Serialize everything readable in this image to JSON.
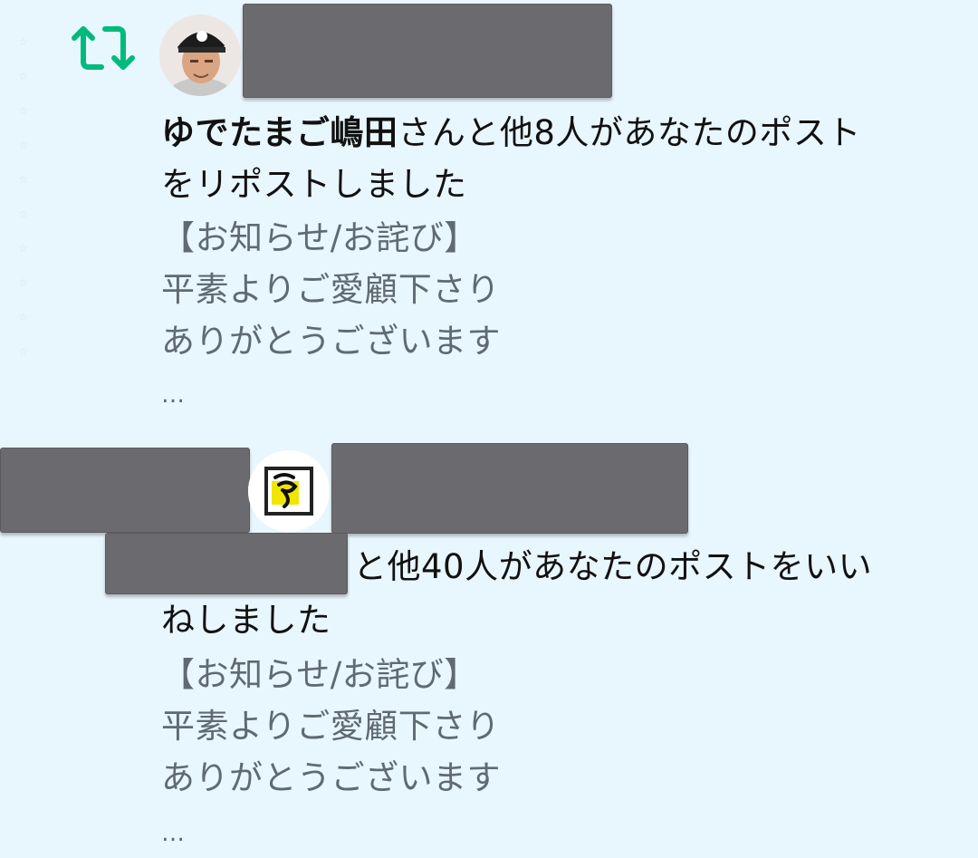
{
  "notifications": [
    {
      "type": "repost",
      "icon": "repost-icon",
      "actor_name": "ゆでたまご嶋田",
      "summary_rest": "さんと他8人があなたのポスト",
      "summary_line2": "をリポストしました",
      "preview_lines": [
        "【お知らせ/お詫び】",
        "平素よりご愛顧下さり",
        "ありがとうございます"
      ],
      "ellipsis": "…"
    },
    {
      "type": "like",
      "summary_rest": "と他40人があなたのポストをいい",
      "summary_line2": "ねしました",
      "preview_lines": [
        "【お知らせ/お詫び】",
        "平素よりご愛顧下さり",
        "ありがとうございます"
      ],
      "ellipsis": "…"
    }
  ],
  "colors": {
    "background": "#e8f6fd",
    "repost_green": "#00ba7c",
    "redaction": "#6b6b6f",
    "preview_text": "#5f6a73"
  }
}
